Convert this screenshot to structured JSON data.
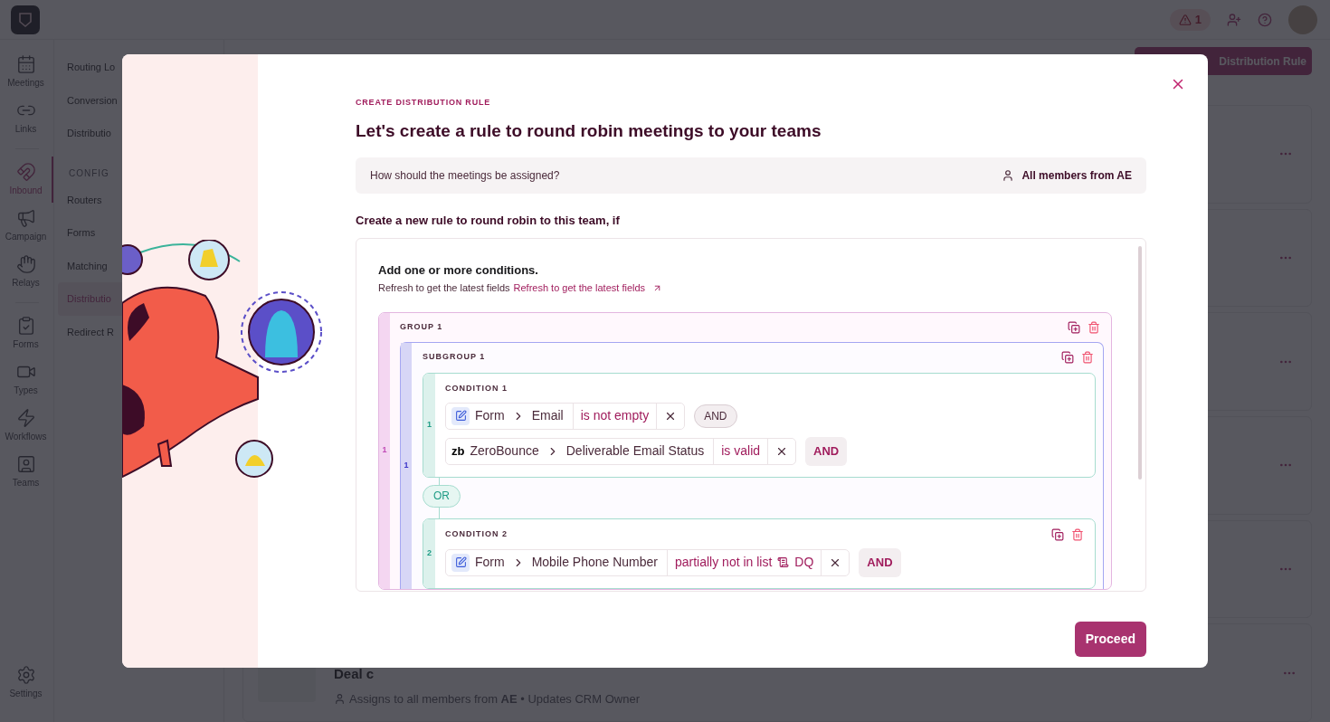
{
  "topbar": {
    "alert_count": "1"
  },
  "rail": {
    "items": [
      {
        "label": "Meetings",
        "selected": false
      },
      {
        "label": "Links",
        "selected": false
      },
      {
        "label": "Inbound",
        "selected": true
      },
      {
        "label": "Campaign",
        "selected": false
      },
      {
        "label": "Relays",
        "selected": false
      },
      {
        "label": "Forms",
        "selected": false
      },
      {
        "label": "Types",
        "selected": false
      },
      {
        "label": "Workflows",
        "selected": false
      },
      {
        "label": "Teams",
        "selected": false
      }
    ],
    "bottom": {
      "label": "Settings",
      "selected": false
    }
  },
  "nav": {
    "items": [
      {
        "label": "Routing Lo",
        "selected": false
      },
      {
        "label": "Conversion",
        "selected": false
      },
      {
        "label": "Distributio",
        "selected": false
      }
    ],
    "section": "CONFIG",
    "config_items": [
      {
        "label": "Routers",
        "selected": false
      },
      {
        "label": "Forms",
        "selected": false
      },
      {
        "label": "Matching",
        "selected": false
      },
      {
        "label": "Distributio",
        "selected": true
      },
      {
        "label": "Redirect R",
        "selected": false
      }
    ]
  },
  "main": {
    "header_button": "Distribution Rule",
    "cards": [
      {
        "title": "Deal c",
        "subtitle": "Assigns to all members from **AE** • Updates CRM Owner"
      }
    ]
  },
  "modal": {
    "eyebrow": "CREATE DISTRIBUTION RULE",
    "title": "Let's create a rule to round robin meetings to your teams",
    "assign_question": "How should the meetings be assigned?",
    "assignee": "All members from AE",
    "rule_prompt": "Create a new rule to round robin to this team, if",
    "conditions_title": "Add one or more conditions.",
    "refresh_text": "Refresh to get the latest fields",
    "refresh_link": "Refresh to get the latest fields",
    "groups": [
      {
        "label": "GROUP 1",
        "index": "1",
        "subgroups": [
          {
            "label": "SUBGROUP 1",
            "index": "1",
            "conditions": [
              {
                "label": "CONDITION 1",
                "index": "1",
                "actions": false,
                "rules": [
                  {
                    "kind": "form",
                    "source": "Form",
                    "field": "Email",
                    "operator": "is not empty",
                    "connector": {
                      "label": "AND",
                      "kind": "pill"
                    }
                  },
                  {
                    "kind": "logo",
                    "logo": "zb",
                    "source": "ZeroBounce",
                    "field": "Deliverable Email Status",
                    "operator": "is valid",
                    "connector": {
                      "label": "AND",
                      "kind": "button"
                    }
                  }
                ]
              },
              {
                "label": "CONDITION 2",
                "index": "2",
                "actions": true,
                "rules": [
                  {
                    "kind": "form",
                    "source": "Form",
                    "field": "Mobile Phone Number",
                    "operator": "partially not in list",
                    "value": "DQ",
                    "connector": {
                      "label": "AND",
                      "kind": "button"
                    }
                  }
                ]
              }
            ],
            "joiner": "OR"
          }
        ]
      }
    ],
    "proceed": "Proceed"
  }
}
